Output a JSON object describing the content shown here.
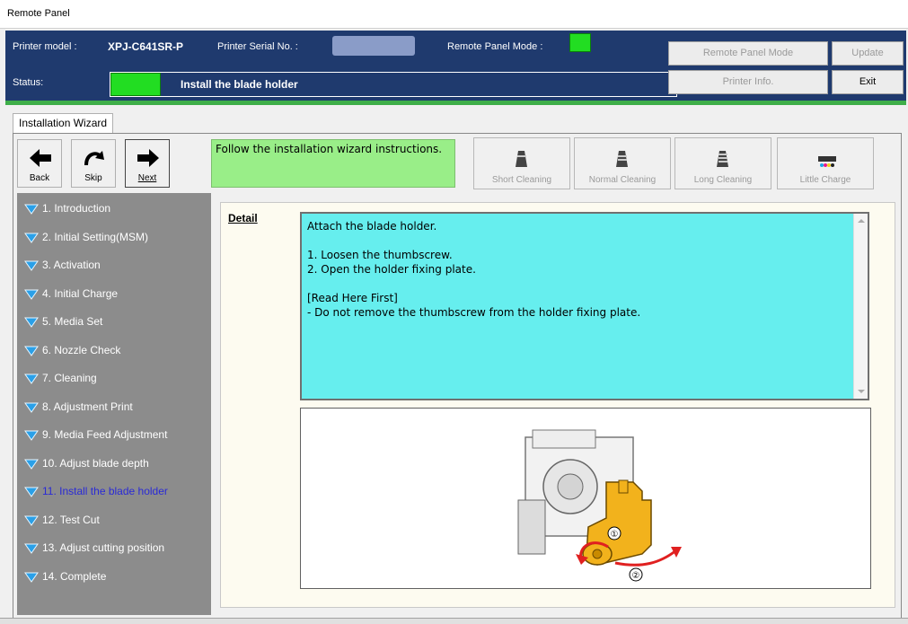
{
  "window": {
    "title": "Remote Panel"
  },
  "header": {
    "printer_model_label": "Printer model :",
    "printer_model_value": "XPJ-C641SR-P",
    "serial_label": "Printer Serial No. :",
    "mode_label": "Remote Panel Mode :",
    "status_label": "Status:",
    "status_text": "Install the blade holder",
    "buttons": {
      "remote_panel_mode": "Remote Panel Mode",
      "update": "Update",
      "printer_info": "Printer Info.",
      "exit": "Exit"
    },
    "colors": {
      "bar": "#1f3a6e",
      "indicator": "#22dd22",
      "accent": "#3fae49"
    }
  },
  "tab": {
    "label": "Installation Wizard"
  },
  "nav": {
    "back": "Back",
    "skip": "Skip",
    "next": "Next"
  },
  "message": "Follow the installation wizard instructions.",
  "tools": {
    "short_cleaning": "Short Cleaning",
    "normal_cleaning": "Normal Cleaning",
    "long_cleaning": "Long Cleaning",
    "little_charge": "Little Charge"
  },
  "steps": [
    "1. Introduction",
    "2. Initial Setting(MSM)",
    "3. Activation",
    "4. Initial Charge",
    "5. Media Set",
    "6. Nozzle Check",
    "7. Cleaning",
    "8. Adjustment Print",
    "9. Media Feed Adjustment",
    "10. Adjust blade depth",
    "11. Install the blade holder",
    "12. Test Cut",
    "13. Adjust cutting position",
    "14. Complete"
  ],
  "active_step_index": 10,
  "detail": {
    "label": "Detail",
    "lines": [
      "Attach the blade holder.",
      "",
      "1. Loosen the thumbscrew.",
      "2. Open the holder fixing plate.",
      "",
      "[Read Here First]",
      "- Do not remove the thumbscrew from the holder fixing plate."
    ],
    "illustration_markers": [
      "①",
      "②"
    ]
  }
}
